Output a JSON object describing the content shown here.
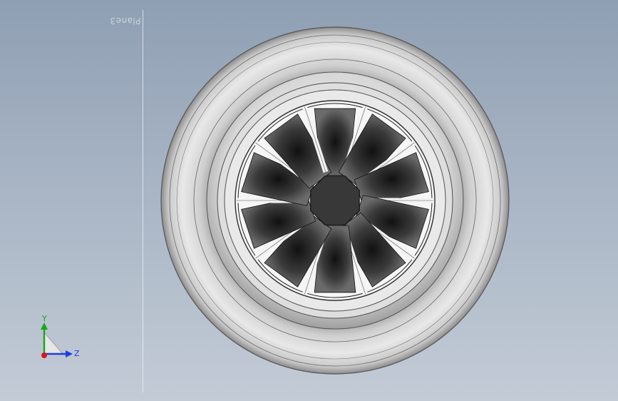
{
  "viewport": {
    "plane_label": "Plane3"
  },
  "triad": {
    "y_label": "Y",
    "z_label": "Z",
    "y_color": "#1aa51a",
    "z_color": "#1c3fe0",
    "x_color": "#d41a1a"
  },
  "colors": {
    "tire": "#d7d7d7",
    "rim": "#e3e3e3",
    "spoke_dark": "#2a2a2a",
    "hub": "#3a3a3a"
  },
  "icons": {
    "triad": "view-orientation-triad-icon"
  }
}
